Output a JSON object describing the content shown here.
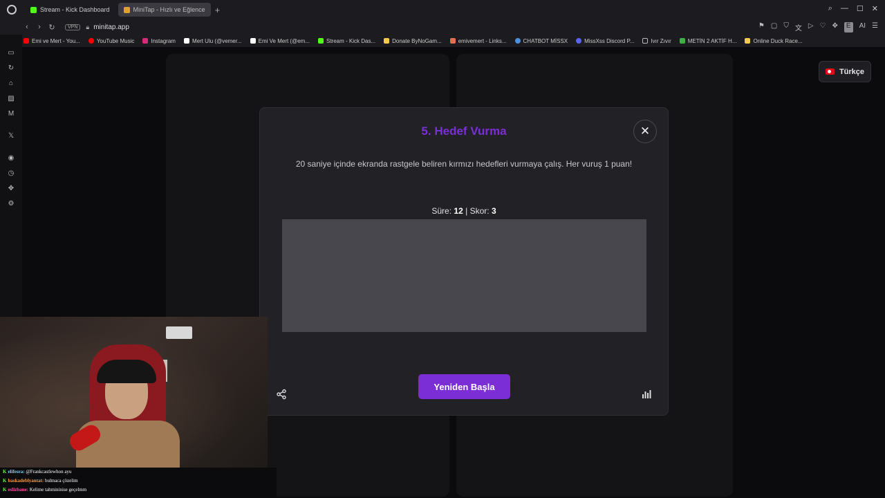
{
  "browser": {
    "tabs": [
      {
        "label": "Stream - Kick Dashboard",
        "color": "#53fc18",
        "active": false
      },
      {
        "label": "MiniTap - Hızlı ve Eğlence",
        "color": "#e0a030",
        "active": true
      }
    ],
    "new_tab": "+",
    "url": "minitap.app",
    "vpn_label": "VPN",
    "ai_label": "AI",
    "bookmarks": [
      {
        "label": "Emi ve Mert - You...",
        "color": "#ff0000"
      },
      {
        "label": "YouTube Music",
        "color": "#ff0000"
      },
      {
        "label": "Instagram",
        "color": "#d62976"
      },
      {
        "label": "Mert Ulu (@vemer...",
        "color": "#ffffff"
      },
      {
        "label": "Emi Ve Mert (@em...",
        "color": "#ffffff"
      },
      {
        "label": "Stream - Kick Das...",
        "color": "#53fc18"
      },
      {
        "label": "Donate ByNoGam...",
        "color": "#f2c94c"
      },
      {
        "label": "emivemert - Links...",
        "color": "#e07050"
      },
      {
        "label": "CHATBOT MİSSX",
        "color": "#4a90e2"
      },
      {
        "label": "MissXss Discord P...",
        "color": "#5865f2"
      },
      {
        "label": "Ivır Zıvır",
        "color": "#bbbbbb"
      },
      {
        "label": "METİN 2 AKTİF H...",
        "color": "#3cb043"
      },
      {
        "label": "Online Duck Race...",
        "color": "#f2c94c"
      }
    ]
  },
  "page": {
    "language_label": "Türkçe"
  },
  "modal": {
    "title": "5. Hedef Vurma",
    "description": "20 saniye içinde ekranda rastgele beliren kırmızı hedefleri vurmaya çalış. Her vuruş 1 puan!",
    "time_label": "Süre:",
    "time_value": "12",
    "separator": "|",
    "score_label": "Skor:",
    "score_value": "3",
    "restart_label": "Yeniden Başla",
    "accent_color": "#7b2ed6"
  },
  "chat": {
    "lines": [
      {
        "user": "elifesra:",
        "text": "@Frankcastlewhon ayu",
        "color": "#7ad0ff"
      },
      {
        "user": "baskadeblyantat:",
        "text": "bulmaca çözelim",
        "color": "#ff9a3c"
      },
      {
        "user": "eslizbane:",
        "text": "Kelime tahmininise geçelmm",
        "color": "#ff4da6"
      }
    ]
  }
}
